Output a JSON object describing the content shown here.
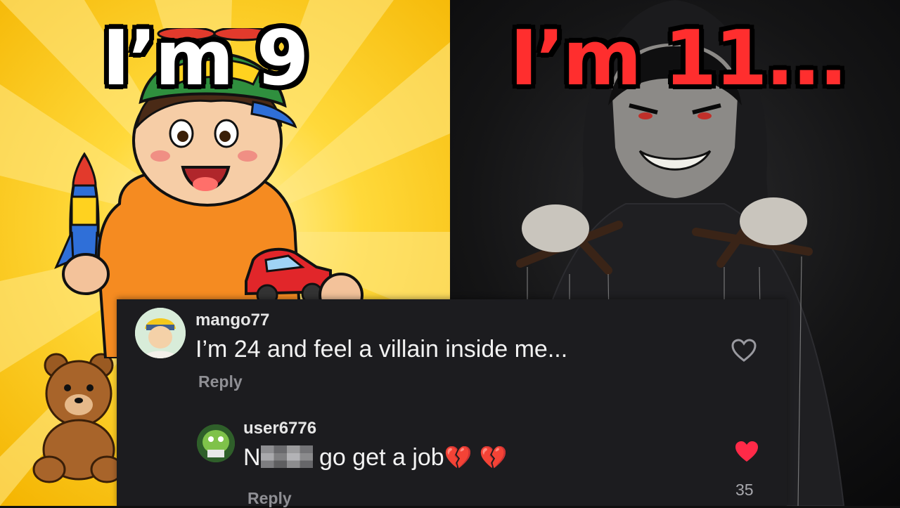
{
  "thumbnail": {
    "left_headline": "I’m 9",
    "right_headline": "I’m 11..."
  },
  "comments": {
    "main": {
      "username": "mango77",
      "text": "I’m 24 and feel a villain inside me...",
      "reply_label": "Reply",
      "liked": false
    },
    "reply": {
      "username": "user6776",
      "text_prefix": "N",
      "text_suffix": " go get a job",
      "emoji": "💔 💔",
      "reply_label": "Reply",
      "liked": true,
      "like_count": "35"
    }
  },
  "icons": {
    "heart_outline": "heart-outline-icon",
    "heart_filled": "heart-filled-icon",
    "broken_heart": "broken-heart-emoji"
  },
  "colors": {
    "left_bg": "#ffd93a",
    "right_bg": "#141415",
    "right_headline": "#ff2e2e",
    "card_bg": "#1c1c1f",
    "liked_heart": "#ff2a48"
  }
}
